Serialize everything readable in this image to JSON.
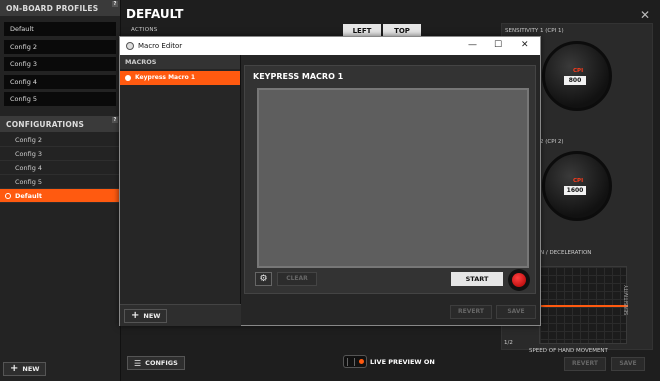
{
  "sidebar": {
    "profiles_title": "ON-BOARD PROFILES",
    "profiles": [
      "Default",
      "Config 2",
      "Config 3",
      "Config 4",
      "Config 5"
    ],
    "configs_title": "CONFIGURATIONS",
    "configs": [
      "Config 2",
      "Config 3",
      "Config 4",
      "Config 5",
      "Default"
    ],
    "active_config": "Default",
    "new_label": "NEW",
    "help_glyph": "?"
  },
  "main": {
    "title": "DEFAULT",
    "actions_label": "ACTIONS",
    "left_label": "LEFT",
    "top_label": "TOP",
    "sensitivity1": "SENSITIVITY 1 (CPI 1)",
    "sensitivity2_partial": "2 (CPI 2)",
    "cpi_label": "CPI",
    "cpi1_value": "800",
    "cpi2_value": "1600",
    "accel_label": "N / DECELERATION",
    "sensitivity_vertical": "SENSITIVITY",
    "speed_label": "SPEED OF HAND MOVEMENT",
    "graph_corner": "1/2",
    "configs_btn": "CONFIGS",
    "live_preview": "LIVE PREVIEW ON",
    "revert_label": "REVERT",
    "save_label": "SAVE"
  },
  "editor": {
    "window_title": "Macro Editor",
    "macros_head": "MACROS",
    "macro_item": "Keypress Macro 1",
    "macro_title": "KEYPRESS MACRO 1",
    "clear_label": "CLEAR",
    "start_label": "START",
    "new_label": "NEW",
    "revert_label": "REVERT",
    "save_label": "SAVE"
  },
  "colors": {
    "accent": "#ff5a10",
    "record": "#d01010"
  },
  "icons": [
    "close-icon",
    "minimize-icon",
    "maximize-icon",
    "gear-icon",
    "plus-icon",
    "list-icon",
    "record-icon",
    "help-icon"
  ]
}
